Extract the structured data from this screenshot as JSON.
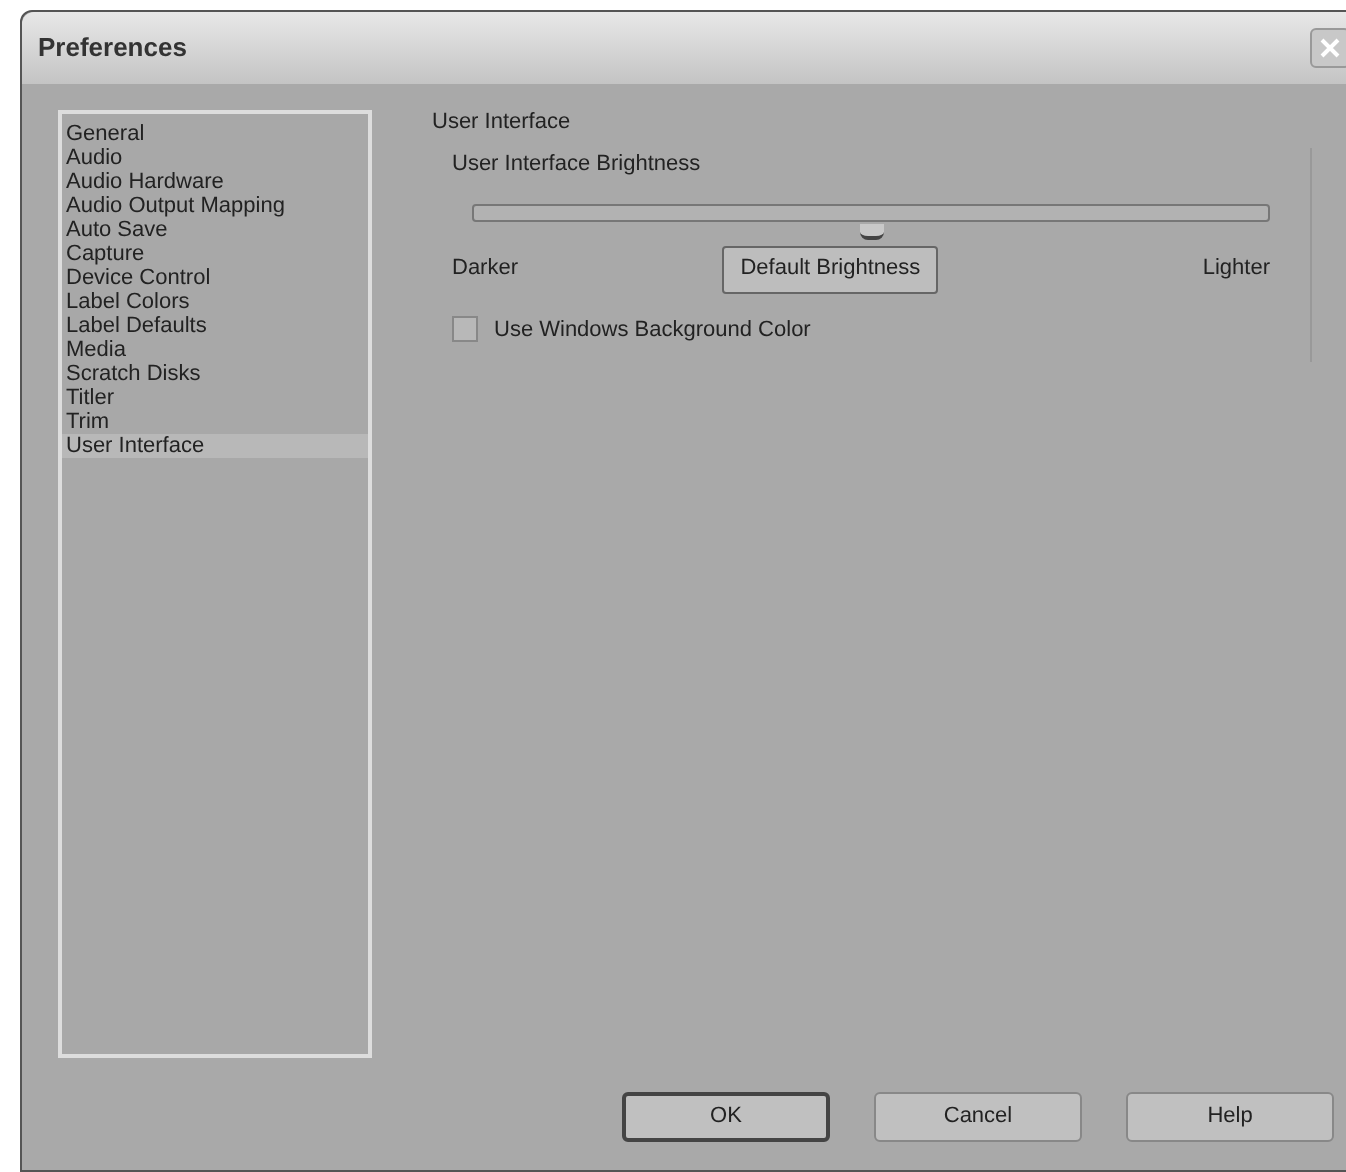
{
  "window": {
    "title": "Preferences"
  },
  "sidebar": {
    "items": [
      {
        "label": "General",
        "selected": false
      },
      {
        "label": "Audio",
        "selected": false
      },
      {
        "label": "Audio Hardware",
        "selected": false
      },
      {
        "label": "Audio Output Mapping",
        "selected": false
      },
      {
        "label": "Auto Save",
        "selected": false
      },
      {
        "label": "Capture",
        "selected": false
      },
      {
        "label": "Device Control",
        "selected": false
      },
      {
        "label": "Label Colors",
        "selected": false
      },
      {
        "label": "Label Defaults",
        "selected": false
      },
      {
        "label": "Media",
        "selected": false
      },
      {
        "label": "Scratch Disks",
        "selected": false
      },
      {
        "label": "Titler",
        "selected": false
      },
      {
        "label": "Trim",
        "selected": false
      },
      {
        "label": "User Interface",
        "selected": true
      }
    ]
  },
  "panel": {
    "title": "User Interface",
    "group_label": "User Interface Brightness",
    "slider": {
      "level": 0.5
    },
    "min_label": "Darker",
    "max_label": "Lighter",
    "default_button": "Default Brightness",
    "checkbox": {
      "label": "Use Windows Background Color",
      "checked": false
    }
  },
  "buttons": [
    {
      "label": "OK",
      "default": true
    },
    {
      "label": "Cancel",
      "default": false
    },
    {
      "label": "Help",
      "default": false
    }
  ]
}
